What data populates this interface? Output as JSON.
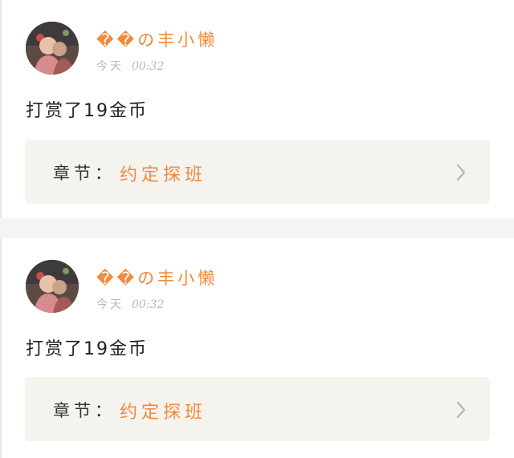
{
  "records": [
    {
      "username": "��の丰小懒",
      "day": "今天",
      "time": "00:32",
      "content": "打赏了19金币",
      "chapter_label": "章节：",
      "chapter_title": "约定探班"
    },
    {
      "username": "��の丰小懒",
      "day": "今天",
      "time": "00:32",
      "content": "打赏了19金币",
      "chapter_label": "章节：",
      "chapter_title": "约定探班"
    }
  ],
  "colors": {
    "accent": "#f08a3c",
    "text": "#222222",
    "muted": "#b8b8b8",
    "chapter_bg": "#f4f3ee",
    "divider": "#f4f4f4"
  },
  "icons": {
    "avatar": "avatar",
    "arrow": "chevron-right-icon"
  }
}
